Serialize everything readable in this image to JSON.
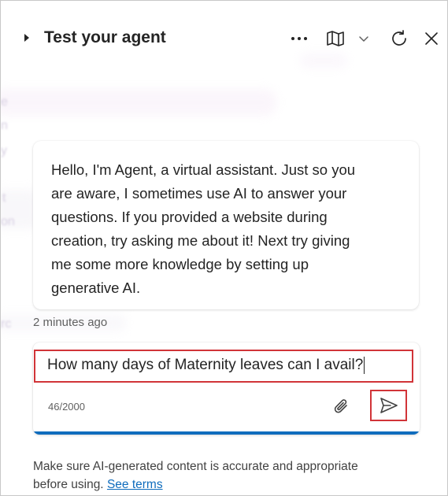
{
  "header": {
    "title": "Test your agent",
    "icons": {
      "collapse": "caret-right-icon",
      "more": "more-horizontal-icon",
      "map": "map-icon",
      "dropdown": "chevron-down-icon",
      "refresh": "refresh-icon",
      "close": "close-icon"
    }
  },
  "conversation": {
    "messages": [
      {
        "sender": "bot",
        "lines": [
          "Hello, I'm Agent, a virtual assistant. Just so you",
          "are aware, I sometimes use AI to answer your",
          "questions. If you provided a website during",
          "creation, try asking me about it! Next try giving",
          "me some more knowledge by setting up",
          "generative AI."
        ],
        "timestamp": "2 minutes ago"
      }
    ]
  },
  "composer": {
    "value": "How many days of Maternity leaves can I avail?",
    "char_count": "46/2000",
    "attach_icon": "paperclip-icon",
    "send_icon": "send-icon"
  },
  "footer": {
    "disclaimer_line1": "Make sure AI-generated content is accurate and appropriate",
    "disclaimer_line2": "before using.",
    "terms_link": "See terms"
  },
  "colors": {
    "accent": "#0f6cbd",
    "highlight_box": "#d13438",
    "text": "#242424"
  }
}
